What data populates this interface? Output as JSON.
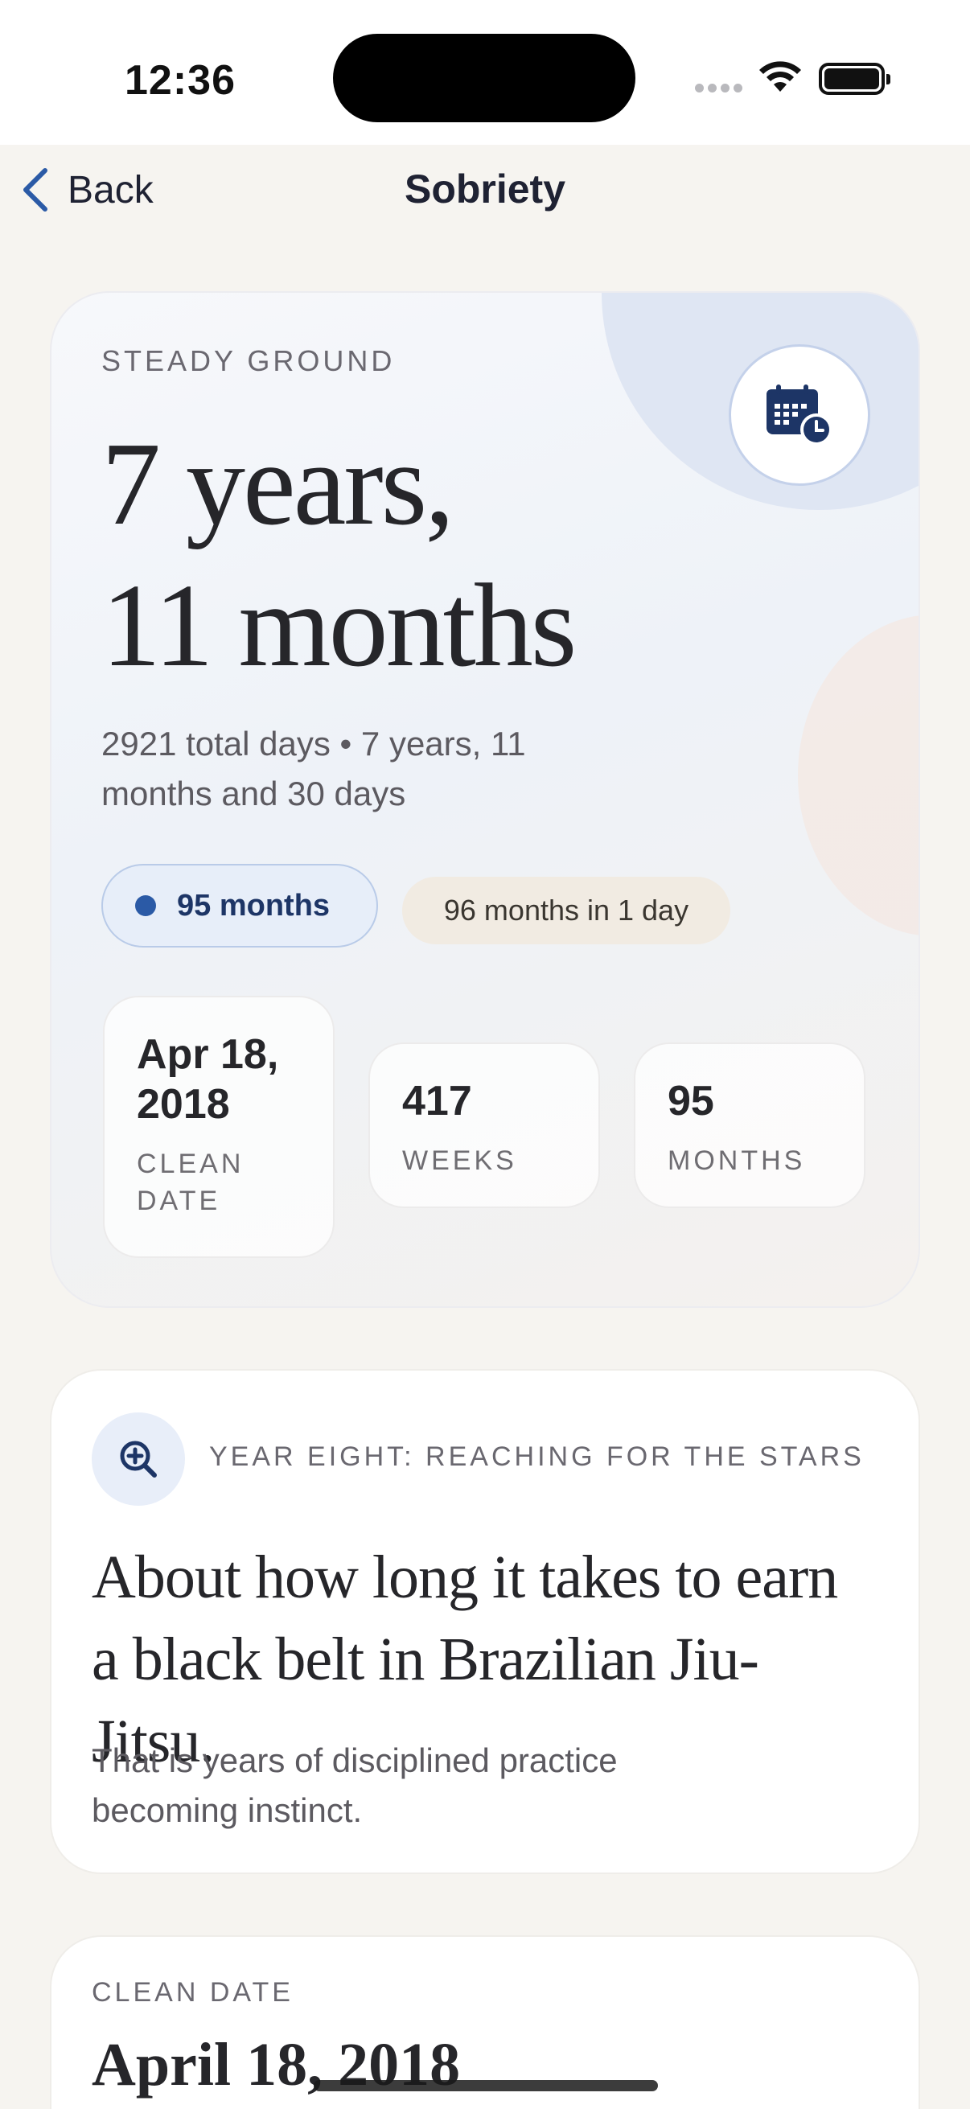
{
  "status_bar": {
    "time": "12:36"
  },
  "nav": {
    "back_label": "Back",
    "title": "Sobriety"
  },
  "hero": {
    "eyebrow": "STEADY GROUND",
    "title_line1": "7 years,",
    "title_line2": "11 months",
    "subtitle": "2921 total days • 7 years, 11 months and 30 days",
    "pill_current": "95 months",
    "pill_next": "96 months in 1 day",
    "stats": [
      {
        "value": "Apr 18, 2018",
        "label": "CLEAN DATE"
      },
      {
        "value": "417",
        "label": "WEEKS"
      },
      {
        "value": "95",
        "label": "MONTHS"
      }
    ],
    "colors": {
      "accent": "#2b5aa6",
      "pill_text": "#1d3566"
    }
  },
  "milestone": {
    "icon": "zoom-in-icon",
    "eyebrow": "YEAR EIGHT: REACHING FOR THE STARS",
    "title": "About how long it takes to earn a black belt in Brazilian Jiu-Jitsu.",
    "body": "That is years of disciplined practice becoming instinct."
  },
  "clean_date": {
    "eyebrow": "CLEAN DATE",
    "value": "April 18, 2018"
  }
}
